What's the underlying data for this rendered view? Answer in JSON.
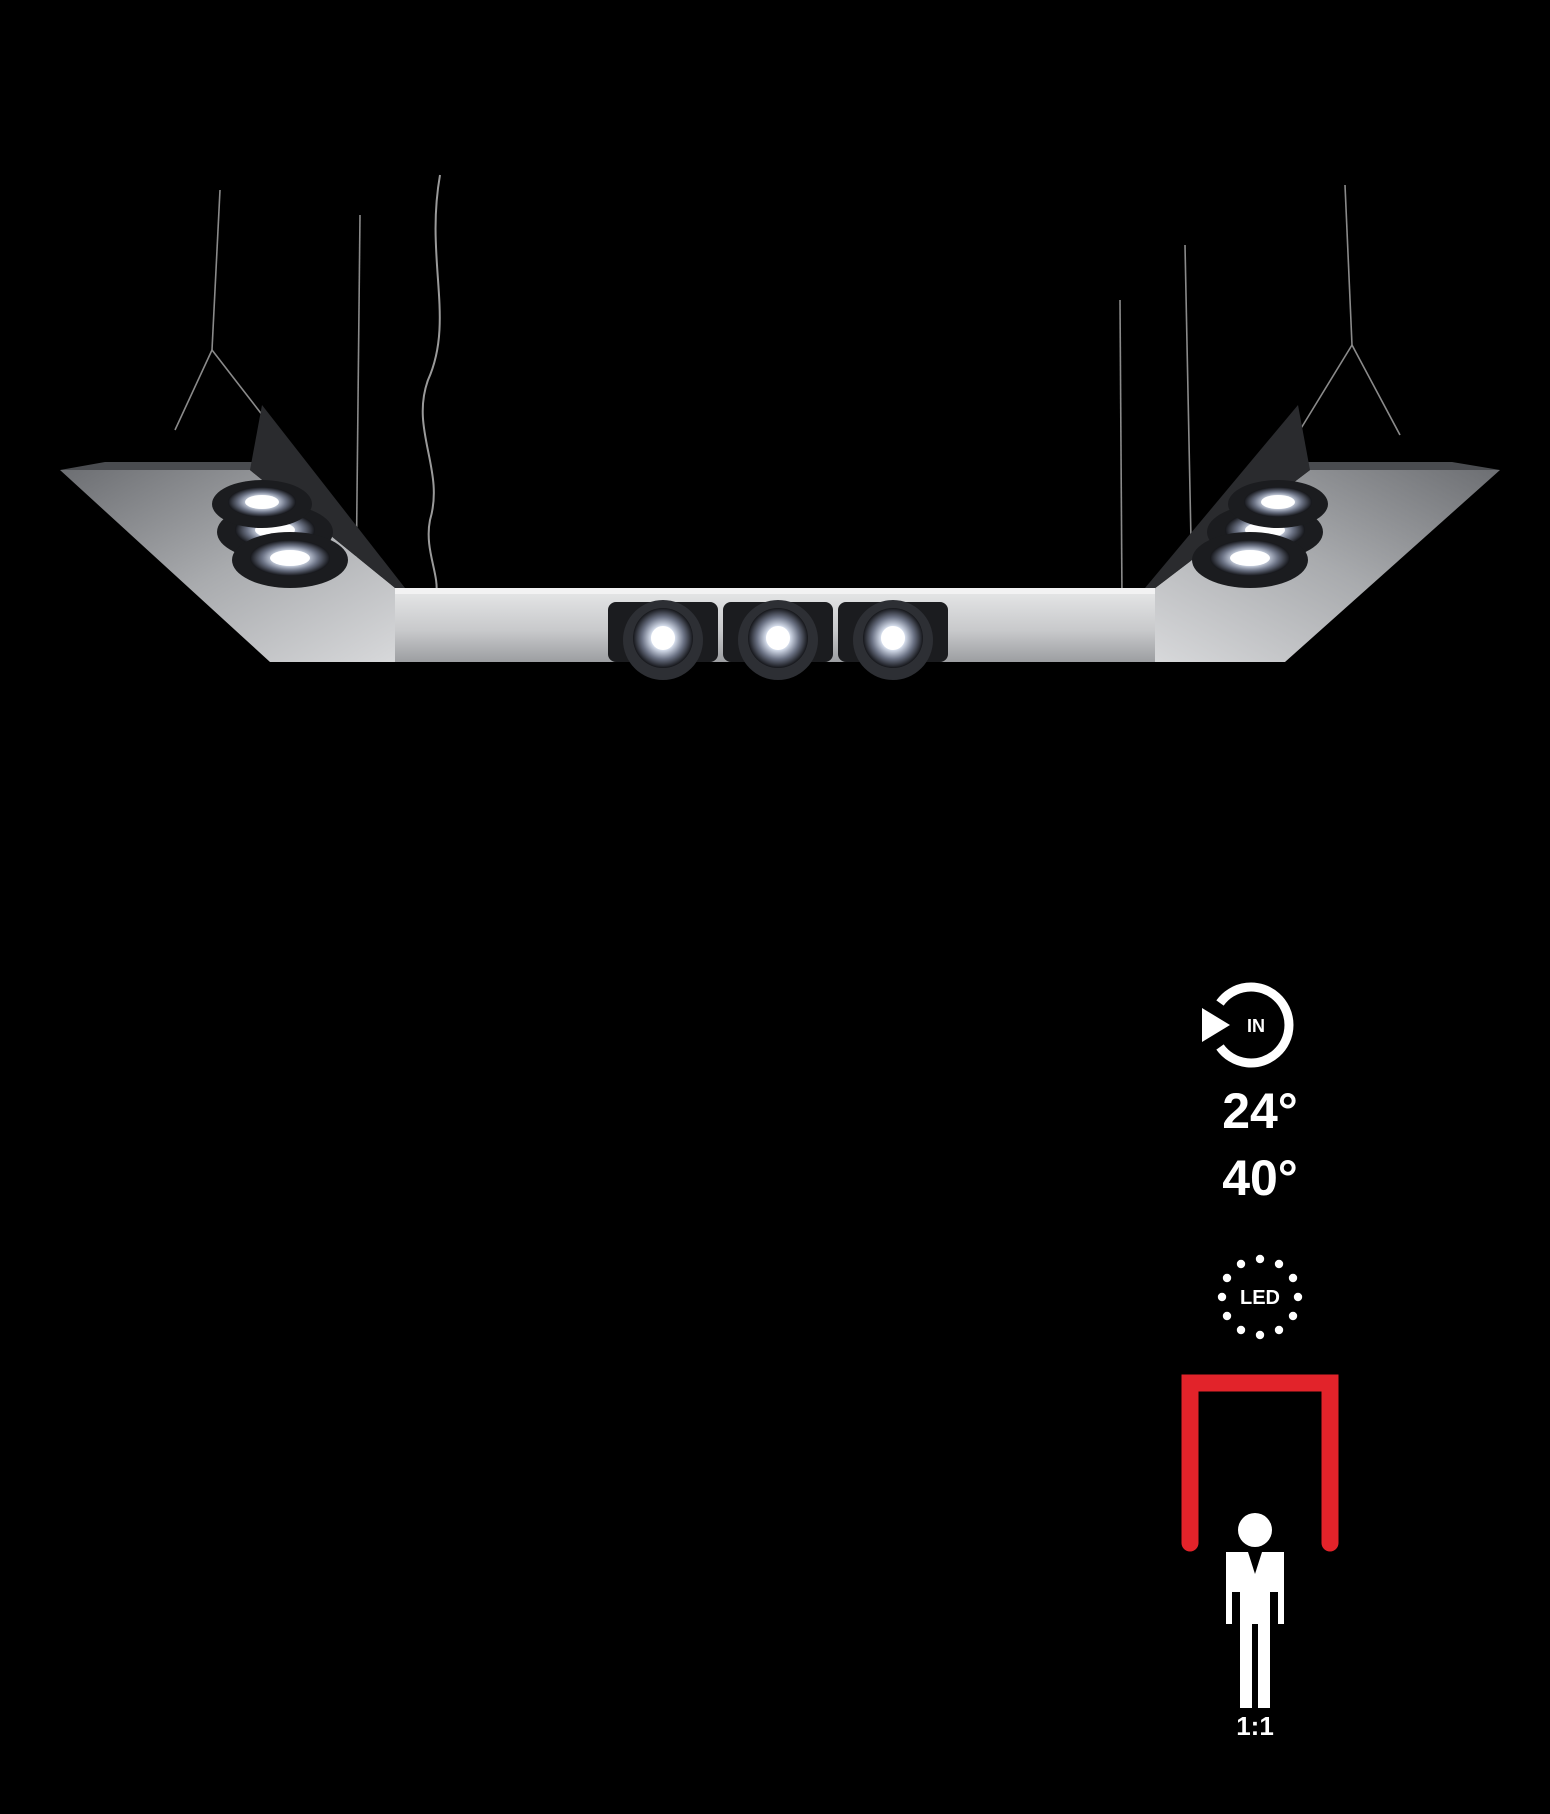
{
  "specs": {
    "mount_icon_text": "IN",
    "beam_angles": [
      "24°",
      "40°"
    ],
    "led_badge_text": "LED",
    "scale_label": "1:1"
  },
  "icons": {
    "mount": "recessed-in-icon",
    "led": "led-icon",
    "shape": "u-shape-icon",
    "person": "person-scale-icon"
  },
  "colors": {
    "background": "#000000",
    "accent": "#e2232a",
    "icon": "#ffffff"
  }
}
